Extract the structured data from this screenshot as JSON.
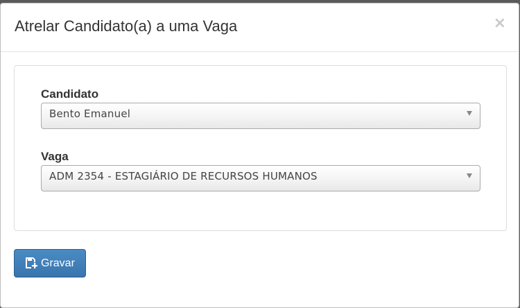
{
  "modal": {
    "title": "Atrelar Candidato(a) a uma Vaga",
    "close_symbol": "×"
  },
  "form": {
    "candidato": {
      "label": "Candidato",
      "selected_value": "Bento Emanuel"
    },
    "vaga": {
      "label": "Vaga",
      "selected_value": "ADM 2354 - ESTAGIÁRIO DE RECURSOS HUMANOS"
    }
  },
  "actions": {
    "save_label": "Gravar",
    "save_icon": "save-plus-icon"
  },
  "colors": {
    "primary_button": "#3a74ad",
    "title_text": "#333333",
    "close_icon": "#c8c8c8"
  }
}
